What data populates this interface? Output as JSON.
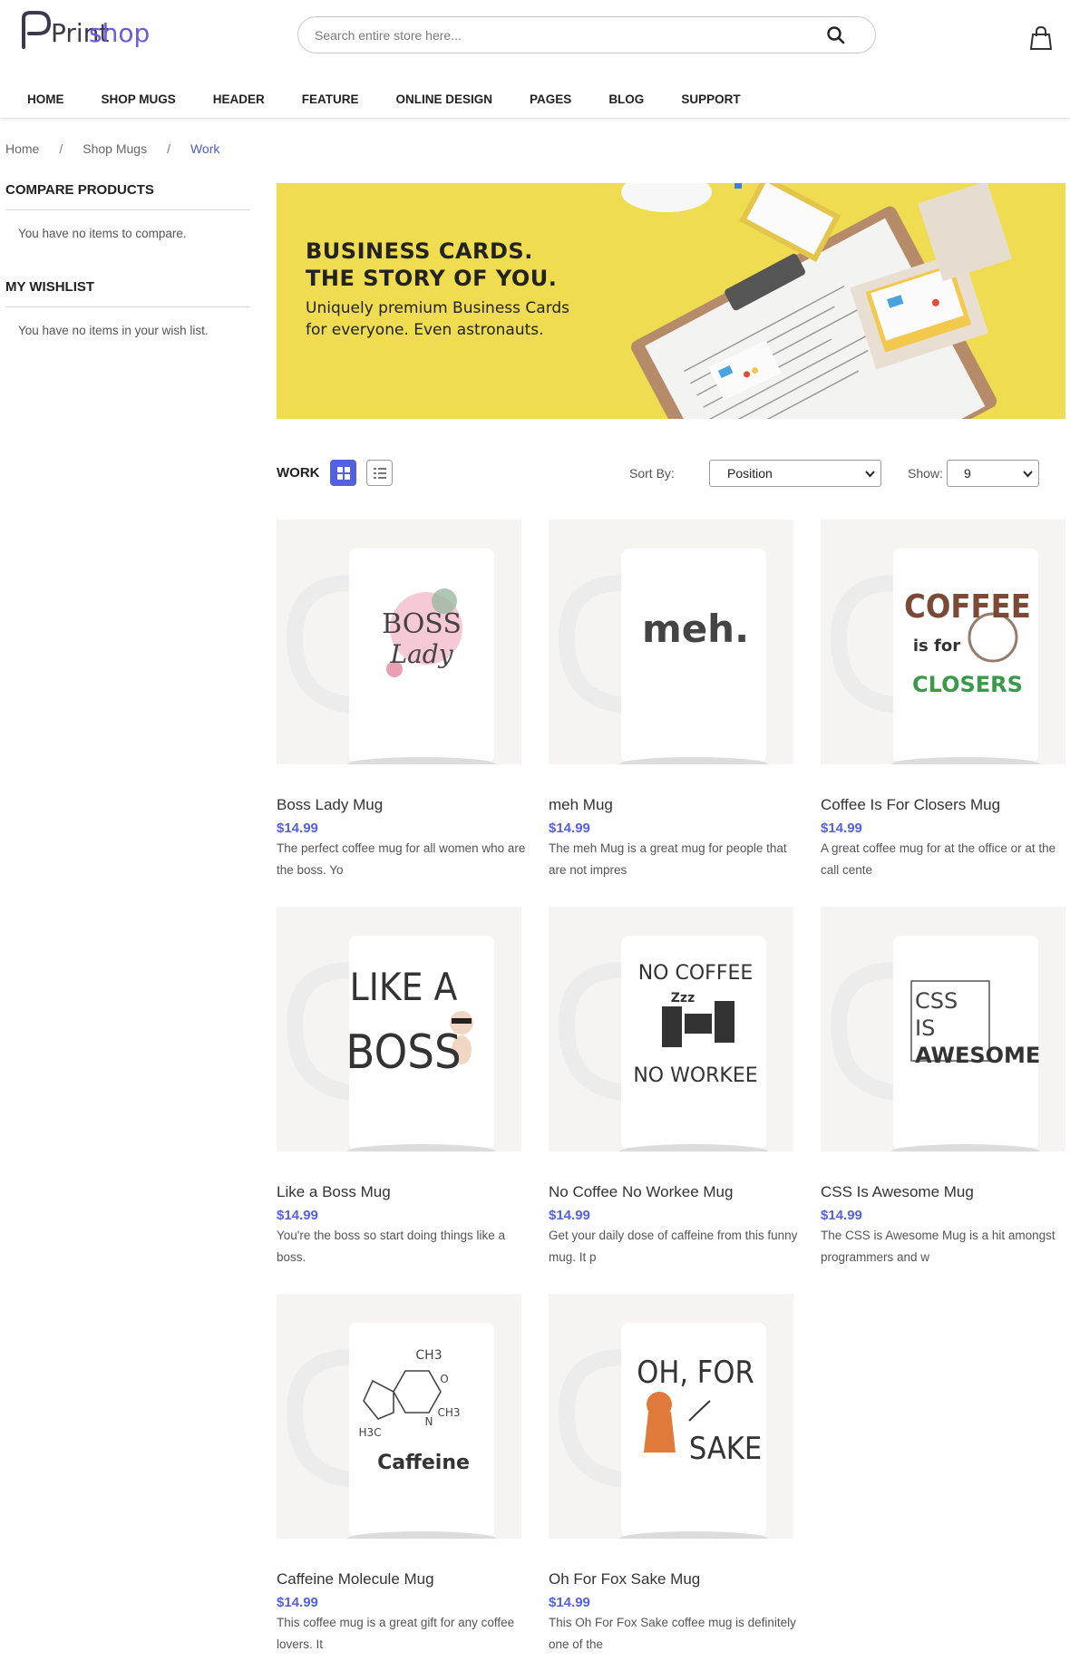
{
  "header": {
    "logo_text_1": "Print",
    "logo_text_2": "shop",
    "search_placeholder": "Search entire store here..."
  },
  "nav": [
    "HOME",
    "SHOP MUGS",
    "HEADER",
    "FEATURE",
    "ONLINE DESIGN",
    "PAGES",
    "BLOG",
    "SUPPORT"
  ],
  "breadcrumb": {
    "items": [
      "Home",
      "Shop Mugs",
      "Work"
    ],
    "sep": "/"
  },
  "sidebar": {
    "compare_title": "COMPARE PRODUCTS",
    "compare_text": "You have no items to compare.",
    "wishlist_title": "MY WISHLIST",
    "wishlist_text": "You have no items in your wish list."
  },
  "banner": {
    "line1": "BUSINESS CARDS.",
    "line2": "THE STORY OF YOU.",
    "sub1": "Uniquely premium Business Cards",
    "sub2": "for everyone. Even astronauts."
  },
  "toolbar": {
    "title": "WORK",
    "sort_label": "Sort By:",
    "sort_value": "Position",
    "show_label": "Show:",
    "show_value": "9"
  },
  "products": [
    {
      "name": "Boss Lady Mug",
      "price": "$14.99",
      "desc": "The perfect coffee mug for all women who are the boss. Yo",
      "art": [
        "BOSS",
        "Lady"
      ]
    },
    {
      "name": "meh Mug",
      "price": "$14.99",
      "desc": "The meh Mug is a great mug for people that are not impres",
      "art": [
        "meh."
      ]
    },
    {
      "name": "Coffee Is For Closers Mug",
      "price": "$14.99",
      "desc": "A great coffee mug for at the office or at the call cente",
      "art": [
        "COFFEE",
        "is for",
        "CLOSERS"
      ]
    },
    {
      "name": "Like a Boss Mug",
      "price": "$14.99",
      "desc": "You're the boss so start doing things like a boss.",
      "art": [
        "LIKE A",
        "BOSS"
      ]
    },
    {
      "name": "No Coffee No Workee Mug",
      "price": "$14.99",
      "desc": "Get your daily dose of caffeine from this funny mug. It p",
      "art": [
        "NO COFFEE",
        "Zzz",
        "NO WORKEE"
      ]
    },
    {
      "name": "CSS Is Awesome Mug",
      "price": "$14.99",
      "desc": "The CSS is Awesome Mug is a hit amongst programmers and w",
      "art": [
        "CSS",
        "IS",
        "AWESOME"
      ]
    },
    {
      "name": "Caffeine Molecule Mug",
      "price": "$14.99",
      "desc": "This coffee mug is a great gift for any coffee lovers. It",
      "art": [
        "Caffeine",
        "CH3",
        "H3C",
        "N",
        "O"
      ]
    },
    {
      "name": "Oh For Fox Sake Mug",
      "price": "$14.99",
      "desc": "This Oh For Fox Sake coffee mug is definitely one of the",
      "art": [
        "OH, FOR",
        "SAKE"
      ]
    }
  ],
  "colors": {
    "accent": "#5461dc",
    "banner_bg": "#f0dc50"
  }
}
